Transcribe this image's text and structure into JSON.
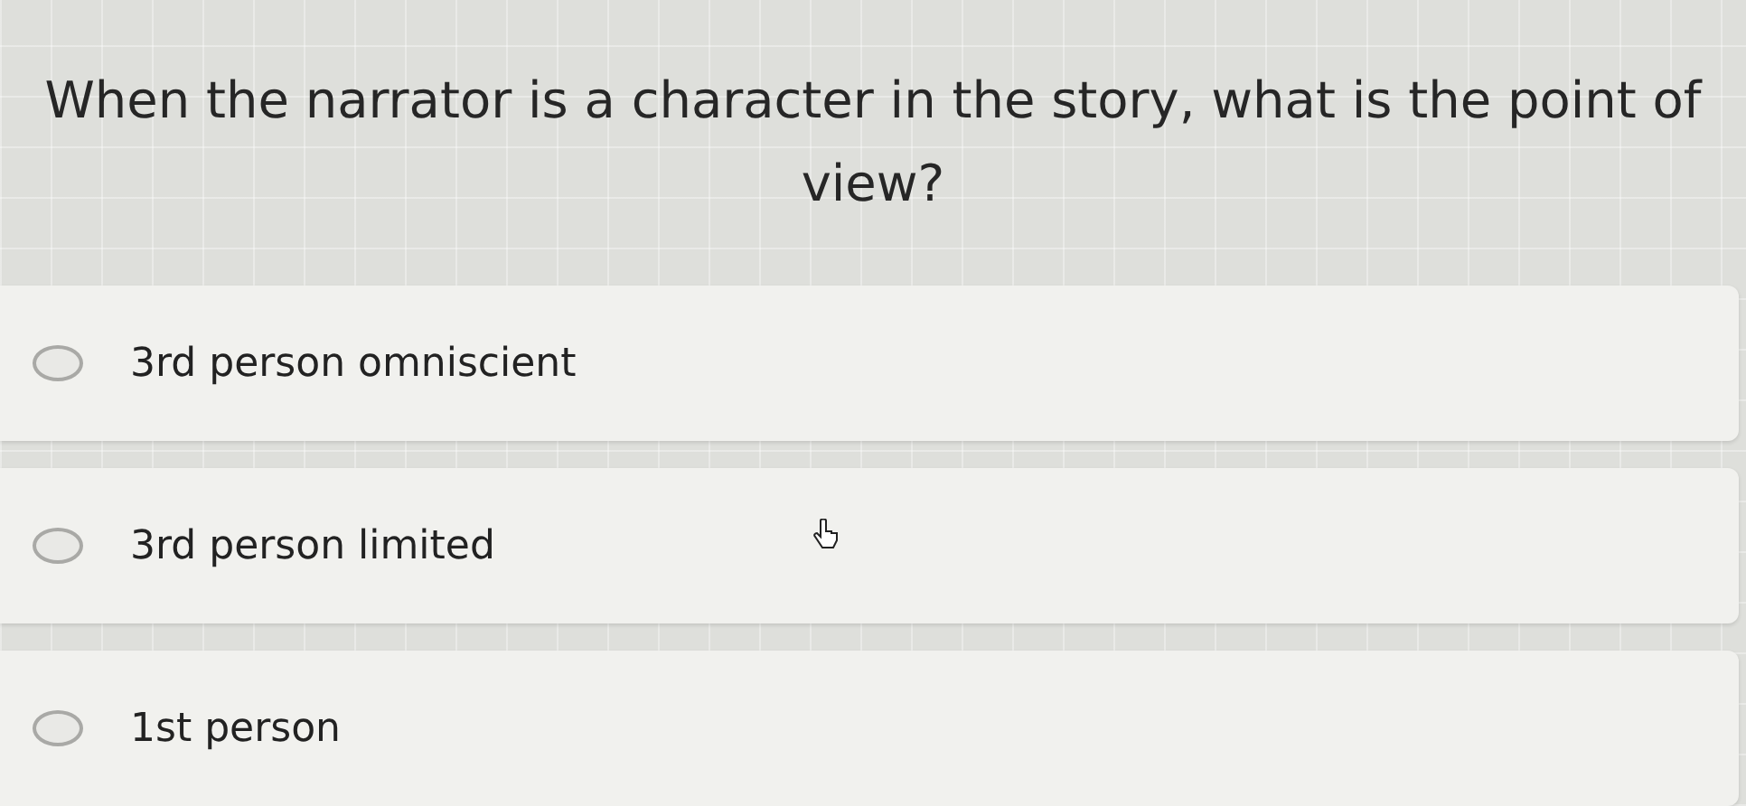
{
  "question": "When the narrator is a character in the story, what is the point of view?",
  "options": [
    {
      "label": "3rd person omniscient",
      "selected": false
    },
    {
      "label": "3rd person limited",
      "selected": false
    },
    {
      "label": "1st person",
      "selected": false
    }
  ]
}
